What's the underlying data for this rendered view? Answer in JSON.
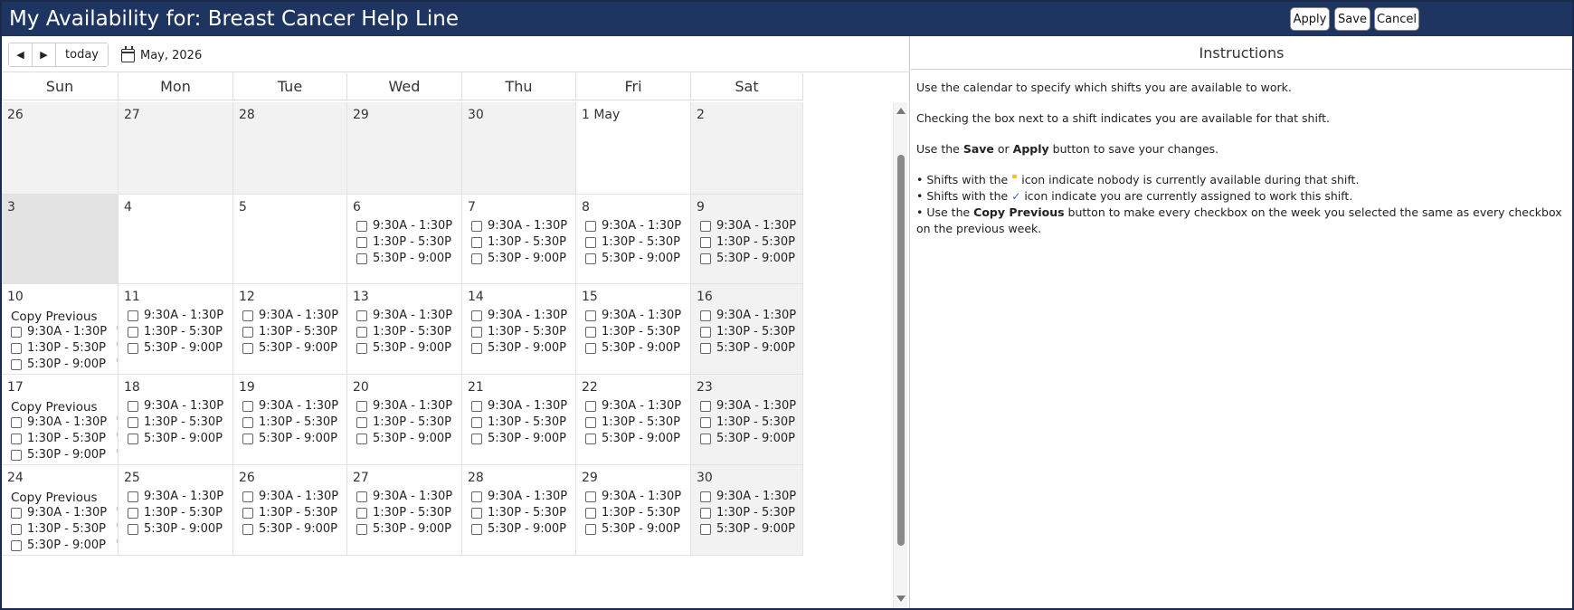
{
  "window": {
    "title": "My Availability for: Breast Cancer Help Line",
    "buttons": {
      "apply": "Apply",
      "save": "Save",
      "cancel": "Cancel"
    }
  },
  "toolbar": {
    "prev": "◀",
    "next": "▶",
    "today": "today",
    "month_label": "May, 2026"
  },
  "weekdays": [
    "Sun",
    "Mon",
    "Tue",
    "Wed",
    "Thu",
    "Fri",
    "Sat"
  ],
  "copy_previous_label": "Copy Previous",
  "shifts": [
    "9:30A - 1:30P",
    "1:30P - 5:30P",
    "5:30P - 9:00P"
  ],
  "weeks": [
    {
      "days": [
        "26",
        "27",
        "28",
        "29",
        "30",
        "1 May",
        "2"
      ]
    },
    {
      "days": [
        "3",
        "4",
        "5",
        "6",
        "7",
        "8",
        "9"
      ]
    },
    {
      "days": [
        "10",
        "11",
        "12",
        "13",
        "14",
        "15",
        "16"
      ]
    },
    {
      "days": [
        "17",
        "18",
        "19",
        "20",
        "21",
        "22",
        "23"
      ]
    },
    {
      "days": [
        "24",
        "25",
        "26",
        "27",
        "28",
        "29",
        "30"
      ]
    }
  ],
  "instructions": {
    "title": "Instructions",
    "p1": "Use the calendar to specify which shifts you are available to work.",
    "p2": "Checking the box next to a shift indicates you are available for that shift.",
    "p3_a": "Use the ",
    "p3_save": "Save",
    "p3_b": " or ",
    "p3_apply": "Apply",
    "p3_c": " button to save your changes.",
    "b1_a": "• Shifts with the",
    "b1_b": "icon indicate nobody is currently available during that shift.",
    "b2_a": "• Shifts with the",
    "b2_check": "✓",
    "b2_b": "icon indicate you are currently assigned to work this shift.",
    "b3_a": "• Use the ",
    "b3_bold": "Copy Previous",
    "b3_b": " button to make every checkbox on the week you selected the same as every checkbox on the previous week."
  },
  "colors": {
    "titlebar": "#1e3461",
    "unstaffed_flag": "#f5c800",
    "assigned_check": "#3a5fb8",
    "other_month_bg": "#f2f2f2",
    "today_bg": "#e3e3e3"
  }
}
